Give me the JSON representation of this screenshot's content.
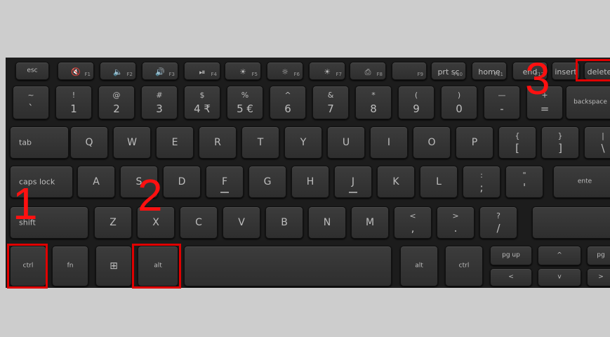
{
  "image": {
    "description_labels": {
      "annotation_1": "1",
      "annotation_2": "2",
      "annotation_3": "3"
    },
    "highlight_color": "#e00000"
  },
  "keys": {
    "esc": "esc",
    "f9": "F9",
    "prtsc": "prt sc",
    "f10": "F10",
    "home": "home",
    "f11": "F11",
    "end": "end",
    "f12": "F12",
    "insert": "insert",
    "delete": "delete",
    "backspace": "backspace",
    "tab": "tab",
    "capslock": "caps lock",
    "shift": "shift",
    "ctrl": "ctrl",
    "fn": "fn",
    "alt": "alt",
    "alt_right": "alt",
    "ctrl_right": "ctrl",
    "pgup": "pg up",
    "pgdn": "pg",
    "enter": "ente",
    "fkeys": [
      "F1",
      "F2",
      "F3",
      "F4",
      "F5",
      "F6",
      "F7",
      "F8"
    ],
    "num_row": [
      {
        "top": "~",
        "bot": "`"
      },
      {
        "top": "!",
        "bot": "1"
      },
      {
        "top": "@",
        "bot": "2"
      },
      {
        "top": "#",
        "bot": "3"
      },
      {
        "top": "$",
        "bot": "4 ₹"
      },
      {
        "top": "%",
        "bot": "5 €"
      },
      {
        "top": "^",
        "bot": "6"
      },
      {
        "top": "&",
        "bot": "7"
      },
      {
        "top": "*",
        "bot": "8"
      },
      {
        "top": "(",
        "bot": "9"
      },
      {
        "top": ")",
        "bot": "0"
      },
      {
        "top": "—",
        "bot": "-"
      },
      {
        "top": "+",
        "bot": "="
      }
    ],
    "row_q": [
      "Q",
      "W",
      "E",
      "R",
      "T",
      "Y",
      "U",
      "I",
      "O",
      "P"
    ],
    "row_q_extra": [
      {
        "top": "{",
        "bot": "["
      },
      {
        "top": "}",
        "bot": "]"
      },
      {
        "top": "|",
        "bot": "\\"
      }
    ],
    "row_a": [
      "A",
      "S",
      "D",
      "F",
      "G",
      "H",
      "J",
      "K",
      "L"
    ],
    "row_a_extra": [
      {
        "top": ":",
        "bot": ";"
      },
      {
        "top": "\"",
        "bot": "'"
      }
    ],
    "row_z": [
      "Z",
      "X",
      "C",
      "V",
      "B",
      "N",
      "M"
    ],
    "row_z_extra": [
      {
        "top": "<",
        "bot": ","
      },
      {
        "top": ">",
        "bot": "."
      },
      {
        "top": "?",
        "bot": "/"
      }
    ],
    "arrows": {
      "up": "^",
      "left": "<",
      "down": "v",
      "right": ">"
    }
  }
}
